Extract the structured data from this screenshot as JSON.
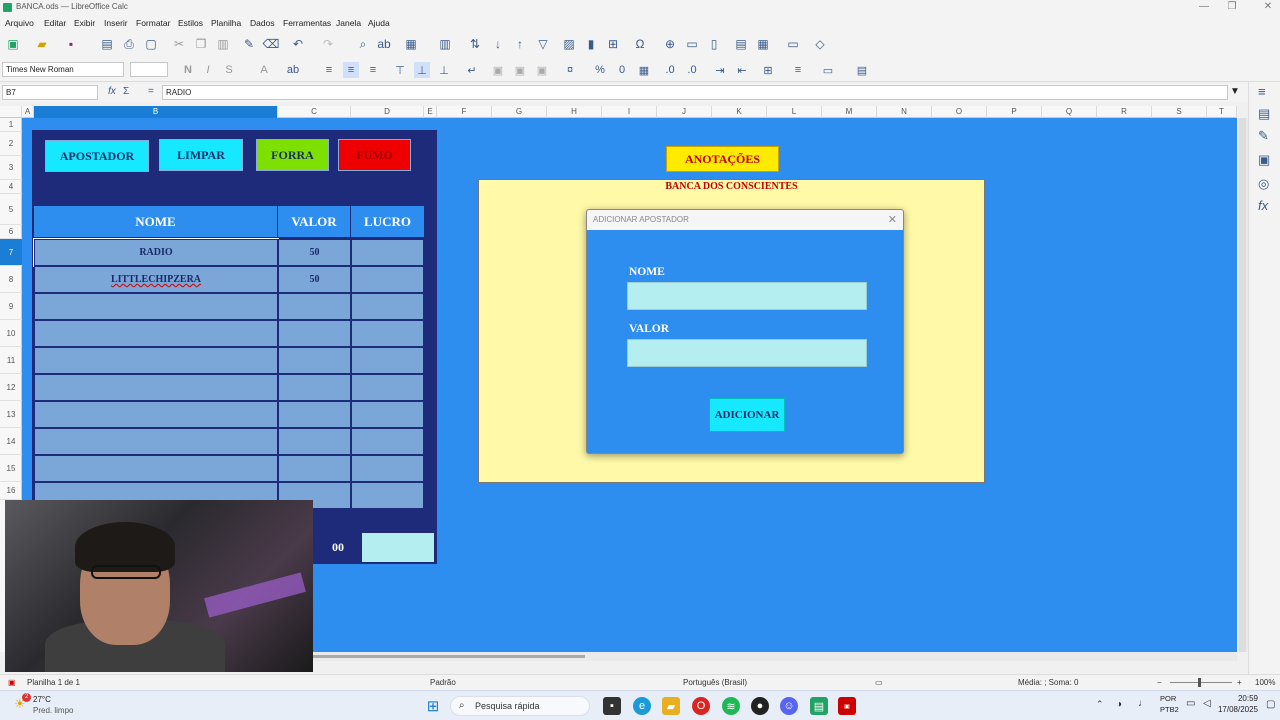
{
  "window": {
    "title": "BANCA.ods — LibreOffice Calc",
    "controls": [
      "—",
      "❐",
      "✕"
    ]
  },
  "menu": [
    "Arquivo",
    "Editar",
    "Exibir",
    "Inserir",
    "Formatar",
    "Estilos",
    "Planilha",
    "Dados",
    "Ferramentas",
    "Janela",
    "Ajuda"
  ],
  "format": {
    "font_name": "Times New Roman",
    "font_size": ""
  },
  "formula": {
    "cell_ref": "B7",
    "content": "RADIO"
  },
  "columns": [
    "A",
    "B",
    "C",
    "D",
    "E",
    "F",
    "G",
    "H",
    "I",
    "J",
    "K",
    "L",
    "M",
    "N",
    "O",
    "P",
    "Q",
    "R",
    "S",
    "T"
  ],
  "rows": [
    "1",
    "2",
    "3",
    "4",
    "5",
    "6",
    "7",
    "8",
    "9",
    "10",
    "11",
    "12",
    "13",
    "14",
    "15",
    "16"
  ],
  "sheet": {
    "buttons": {
      "apostador": "APOSTADOR",
      "limpar": "LIMPAR",
      "forra": "FORRA",
      "fumo": "FUMO"
    },
    "headers": {
      "nome": "NOME",
      "valor": "VALOR",
      "lucro": "LUCRO"
    },
    "entries": [
      {
        "nome": "RADIO",
        "valor": "50",
        "lucro": ""
      },
      {
        "nome": "LITTLECHIPZERA",
        "valor": "50",
        "lucro": ""
      }
    ],
    "total_visible": "00",
    "notes_header": "ANOTAÇÕES",
    "notes_title": "BANCA DOS CONSCIENTES"
  },
  "dialog": {
    "title": "ADICIONAR APOSTADOR",
    "nome_label": "NOME",
    "valor_label": "VALOR",
    "nome_value": "",
    "valor_value": "",
    "submit": "ADICIONAR"
  },
  "status": {
    "sheet": "Planilha 1 de 1",
    "style": "Padrão",
    "language": "Português (Brasil)",
    "summary": "Média: ; Soma: 0",
    "zoom": "100%"
  },
  "taskbar": {
    "weather_temp": "27°C",
    "weather_desc": "Pred. limpo",
    "weather_badge": "2",
    "search_placeholder": "Pesquisa rápida",
    "lang_top": "POR",
    "lang_bottom": "PTB2",
    "time": "20:59",
    "date": "17/08/2025"
  },
  "colors": {
    "sheet_bg": "#2e8ef0",
    "panel": "#1d2b7a",
    "cyan": "#16e8ff",
    "green": "#7ee000",
    "red": "#ee0000",
    "yellow": "#ffeb00",
    "note_bg": "#fff9a8"
  }
}
